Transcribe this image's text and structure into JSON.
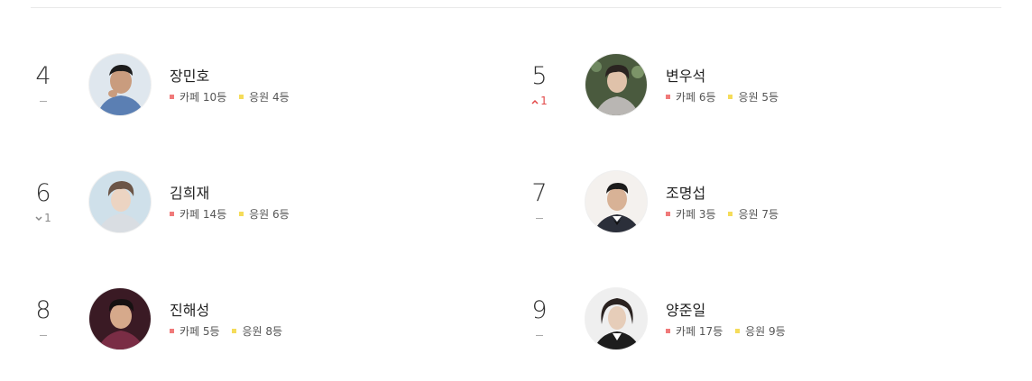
{
  "colors": {
    "cafe_dot": "#f07a7a",
    "cheer_dot": "#f5dc5a",
    "up": "#e24848",
    "down": "#888888"
  },
  "ranking": [
    {
      "rank": "4",
      "change_type": "same",
      "change_value": "",
      "name": "장민호",
      "cafe_label": "카페",
      "cafe_rank": "10등",
      "cheer_label": "응원",
      "cheer_rank": "4등"
    },
    {
      "rank": "5",
      "change_type": "up",
      "change_value": "1",
      "name": "변우석",
      "cafe_label": "카페",
      "cafe_rank": "6등",
      "cheer_label": "응원",
      "cheer_rank": "5등"
    },
    {
      "rank": "6",
      "change_type": "down",
      "change_value": "1",
      "name": "김희재",
      "cafe_label": "카페",
      "cafe_rank": "14등",
      "cheer_label": "응원",
      "cheer_rank": "6등"
    },
    {
      "rank": "7",
      "change_type": "same",
      "change_value": "",
      "name": "조명섭",
      "cafe_label": "카페",
      "cafe_rank": "3등",
      "cheer_label": "응원",
      "cheer_rank": "7등"
    },
    {
      "rank": "8",
      "change_type": "same",
      "change_value": "",
      "name": "진해성",
      "cafe_label": "카페",
      "cafe_rank": "5등",
      "cheer_label": "응원",
      "cheer_rank": "8등"
    },
    {
      "rank": "9",
      "change_type": "same",
      "change_value": "",
      "name": "양준일",
      "cafe_label": "카페",
      "cafe_rank": "17등",
      "cheer_label": "응원",
      "cheer_rank": "9등"
    }
  ]
}
